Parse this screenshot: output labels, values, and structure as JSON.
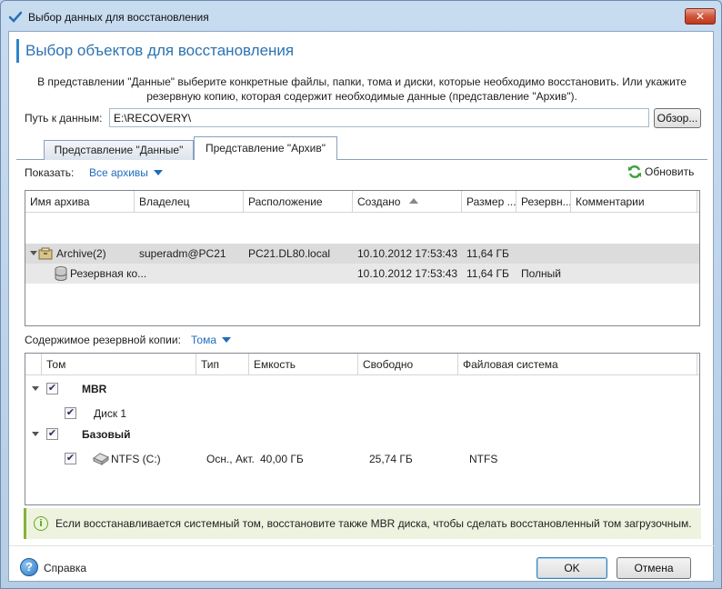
{
  "window": {
    "title": "Выбор данных для восстановления",
    "close_label": "✕"
  },
  "header": {
    "title": "Выбор объектов для восстановления",
    "description_line1": "В представлении \"Данные\" выберите конкретные файлы, папки, тома и диски, которые необходимо восстановить. Или укажите",
    "description_line2": "резервную копию, которая содержит необходимые данные (представление \"Архив\")."
  },
  "path": {
    "label": "Путь к данным:",
    "value": "E:\\RECOVERY\\",
    "browse_label": "Обзор..."
  },
  "tabs": [
    {
      "label": "Представление \"Данные\"",
      "active": false
    },
    {
      "label": "Представление \"Архив\"",
      "active": true
    }
  ],
  "filter": {
    "show_label": "Показать:",
    "show_value": "Все архивы",
    "refresh_label": "Обновить"
  },
  "archives": {
    "columns": [
      "Имя архива",
      "Владелец",
      "Расположение",
      "Создано",
      "Размер ...",
      "Резервн...",
      "Комментарии"
    ],
    "rows": [
      {
        "name": "Archive(2)",
        "owner": "superadm@PC21",
        "location": "PC21.DL80.local",
        "created": "10.10.2012 17:53:43",
        "size": "11,64 ГБ",
        "type": "",
        "comment": ""
      },
      {
        "name": "Резервная ко...",
        "owner": "",
        "location": "",
        "created": "10.10.2012 17:53:43",
        "size": "11,64 ГБ",
        "type": "Полный",
        "comment": ""
      }
    ]
  },
  "contents": {
    "label": "Содержимое резервной копии:",
    "mode": "Тома",
    "columns": [
      "Том",
      "Тип",
      "Емкость",
      "Свободно",
      "Файловая система"
    ],
    "groups": [
      {
        "name": "MBR",
        "checked": true,
        "items": [
          {
            "name": "Диск 1",
            "type": "",
            "capacity": "",
            "free": "",
            "fs": "",
            "checked": true
          }
        ]
      },
      {
        "name": "Базовый",
        "checked": true,
        "items": [
          {
            "name": "NTFS (C:)",
            "type": "Осн., Акт.",
            "capacity": "40,00 ГБ",
            "free": "25,74 ГБ",
            "fs": "NTFS",
            "checked": true
          }
        ]
      }
    ]
  },
  "info": {
    "text": "Если восстанавливается системный том, восстановите также MBR диска, чтобы сделать восстановленный том загрузочным."
  },
  "footer": {
    "help_label": "Справка",
    "ok_label": "OK",
    "cancel_label": "Отмена"
  },
  "colors": {
    "accent": "#2c73b2",
    "link": "#1f6bbd",
    "info_border": "#86b13a"
  }
}
